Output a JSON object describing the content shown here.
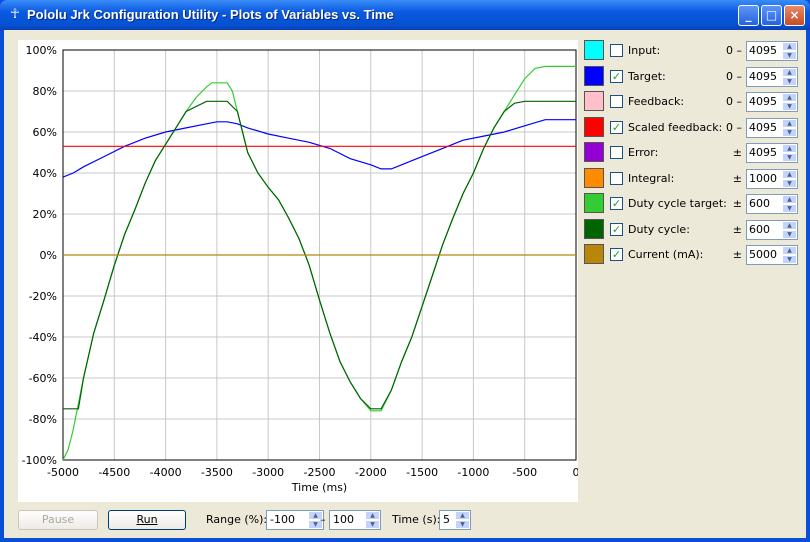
{
  "window": {
    "title": "Pololu Jrk Configuration Utility - Plots of Variables vs. Time",
    "icon": "pololu-figure-icon",
    "buttons": {
      "minimize": "_",
      "maximize": "□",
      "close": "×"
    }
  },
  "chart_data": {
    "type": "line",
    "xlabel": "Time (ms)",
    "ylabel": "",
    "xlim": [
      -5000,
      0
    ],
    "ylim": [
      -100,
      100
    ],
    "x_ticks": [
      "-5000",
      "-4500",
      "-4000",
      "-3500",
      "-3000",
      "-2500",
      "-2000",
      "-1500",
      "-1000",
      "-500",
      "0"
    ],
    "y_ticks": [
      "100%",
      "80%",
      "60%",
      "40%",
      "20%",
      "0%",
      "-20%",
      "-40%",
      "-60%",
      "-80%",
      "-100%"
    ],
    "grid": true,
    "series": [
      {
        "name": "Target",
        "color": "#0000ff",
        "points": [
          [
            -5000,
            38
          ],
          [
            -4900,
            40
          ],
          [
            -4800,
            43
          ],
          [
            -4600,
            48
          ],
          [
            -4400,
            53
          ],
          [
            -4200,
            57
          ],
          [
            -4000,
            60
          ],
          [
            -3800,
            62
          ],
          [
            -3600,
            64
          ],
          [
            -3500,
            65
          ],
          [
            -3400,
            65
          ],
          [
            -3300,
            64
          ],
          [
            -3200,
            62
          ],
          [
            -3000,
            59
          ],
          [
            -2800,
            57
          ],
          [
            -2600,
            55
          ],
          [
            -2400,
            52
          ],
          [
            -2200,
            47
          ],
          [
            -2000,
            44
          ],
          [
            -1900,
            42
          ],
          [
            -1800,
            42
          ],
          [
            -1700,
            44
          ],
          [
            -1500,
            48
          ],
          [
            -1300,
            52
          ],
          [
            -1100,
            56
          ],
          [
            -900,
            58
          ],
          [
            -700,
            60
          ],
          [
            -500,
            63
          ],
          [
            -300,
            66
          ],
          [
            0,
            66
          ]
        ]
      },
      {
        "name": "Scaled feedback",
        "color": "#ff0000",
        "points": [
          [
            -5000,
            53
          ],
          [
            0,
            53
          ]
        ]
      },
      {
        "name": "Duty cycle target",
        "color": "#33cc33",
        "points": [
          [
            -5000,
            -100
          ],
          [
            -4950,
            -95
          ],
          [
            -4900,
            -85
          ],
          [
            -4800,
            -60
          ],
          [
            -4700,
            -38
          ],
          [
            -4600,
            -22
          ],
          [
            -4500,
            -5
          ],
          [
            -4400,
            10
          ],
          [
            -4300,
            22
          ],
          [
            -4200,
            35
          ],
          [
            -4100,
            46
          ],
          [
            -4000,
            54
          ],
          [
            -3900,
            62
          ],
          [
            -3800,
            70
          ],
          [
            -3700,
            77
          ],
          [
            -3600,
            82
          ],
          [
            -3550,
            84
          ],
          [
            -3400,
            84
          ],
          [
            -3350,
            80
          ],
          [
            -3300,
            70
          ],
          [
            -3200,
            50
          ],
          [
            -3100,
            40
          ],
          [
            -3000,
            33
          ],
          [
            -2900,
            27
          ],
          [
            -2800,
            18
          ],
          [
            -2700,
            8
          ],
          [
            -2600,
            -5
          ],
          [
            -2500,
            -22
          ],
          [
            -2400,
            -38
          ],
          [
            -2300,
            -52
          ],
          [
            -2200,
            -62
          ],
          [
            -2100,
            -70
          ],
          [
            -2000,
            -76
          ],
          [
            -1900,
            -76
          ],
          [
            -1800,
            -66
          ],
          [
            -1700,
            -52
          ],
          [
            -1600,
            -40
          ],
          [
            -1500,
            -25
          ],
          [
            -1400,
            -10
          ],
          [
            -1300,
            5
          ],
          [
            -1200,
            18
          ],
          [
            -1100,
            30
          ],
          [
            -1000,
            40
          ],
          [
            -900,
            52
          ],
          [
            -800,
            62
          ],
          [
            -700,
            70
          ],
          [
            -600,
            78
          ],
          [
            -500,
            86
          ],
          [
            -400,
            91
          ],
          [
            -300,
            92
          ],
          [
            0,
            92
          ]
        ]
      },
      {
        "name": "Duty cycle",
        "color": "#006400",
        "points": [
          [
            -5000,
            -75
          ],
          [
            -4850,
            -75
          ],
          [
            -4800,
            -60
          ],
          [
            -4700,
            -38
          ],
          [
            -4600,
            -22
          ],
          [
            -4500,
            -5
          ],
          [
            -4400,
            10
          ],
          [
            -4300,
            22
          ],
          [
            -4200,
            35
          ],
          [
            -4100,
            46
          ],
          [
            -4000,
            54
          ],
          [
            -3900,
            62
          ],
          [
            -3800,
            70
          ],
          [
            -3600,
            75
          ],
          [
            -3400,
            75
          ],
          [
            -3300,
            70
          ],
          [
            -3200,
            50
          ],
          [
            -3100,
            40
          ],
          [
            -3000,
            33
          ],
          [
            -2900,
            27
          ],
          [
            -2800,
            18
          ],
          [
            -2700,
            8
          ],
          [
            -2600,
            -5
          ],
          [
            -2500,
            -22
          ],
          [
            -2400,
            -38
          ],
          [
            -2300,
            -52
          ],
          [
            -2200,
            -62
          ],
          [
            -2100,
            -70
          ],
          [
            -2000,
            -75
          ],
          [
            -1900,
            -75
          ],
          [
            -1800,
            -66
          ],
          [
            -1700,
            -52
          ],
          [
            -1600,
            -40
          ],
          [
            -1500,
            -25
          ],
          [
            -1400,
            -10
          ],
          [
            -1300,
            5
          ],
          [
            -1200,
            18
          ],
          [
            -1100,
            30
          ],
          [
            -1000,
            40
          ],
          [
            -900,
            52
          ],
          [
            -800,
            62
          ],
          [
            -700,
            70
          ],
          [
            -600,
            74
          ],
          [
            -500,
            75
          ],
          [
            0,
            75
          ]
        ]
      },
      {
        "name": "Current (mA)",
        "color": "#b8860b",
        "points": [
          [
            -5000,
            0
          ],
          [
            0,
            0
          ]
        ]
      }
    ]
  },
  "legend": [
    {
      "name": "Input:",
      "color": "#00ffff",
      "checked": false,
      "prefix": "0 –",
      "value": "4095"
    },
    {
      "name": "Target:",
      "color": "#0000ff",
      "checked": true,
      "prefix": "0 –",
      "value": "4095"
    },
    {
      "name": "Feedback:",
      "color": "#ffc0cb",
      "checked": false,
      "prefix": "0 –",
      "value": "4095"
    },
    {
      "name": "Scaled feedback:",
      "color": "#ff0000",
      "checked": true,
      "prefix": "0 –",
      "value": "4095"
    },
    {
      "name": "Error:",
      "color": "#9400d3",
      "checked": false,
      "prefix": "±",
      "value": "4095"
    },
    {
      "name": "Integral:",
      "color": "#ff8c00",
      "checked": false,
      "prefix": "±",
      "value": "1000"
    },
    {
      "name": "Duty cycle target:",
      "color": "#33cc33",
      "checked": true,
      "prefix": "±",
      "value": "600"
    },
    {
      "name": "Duty cycle:",
      "color": "#006400",
      "checked": true,
      "prefix": "±",
      "value": "600"
    },
    {
      "name": "Current (mA):",
      "color": "#b8860b",
      "checked": true,
      "prefix": "±",
      "value": "5000"
    }
  ],
  "controls": {
    "pause_label": "Pause",
    "run_label": "Run",
    "range_label": "Range (%):",
    "range_min": "-100",
    "range_dash": "–",
    "range_max": "100",
    "time_label": "Time (s):",
    "time_value": "5"
  }
}
